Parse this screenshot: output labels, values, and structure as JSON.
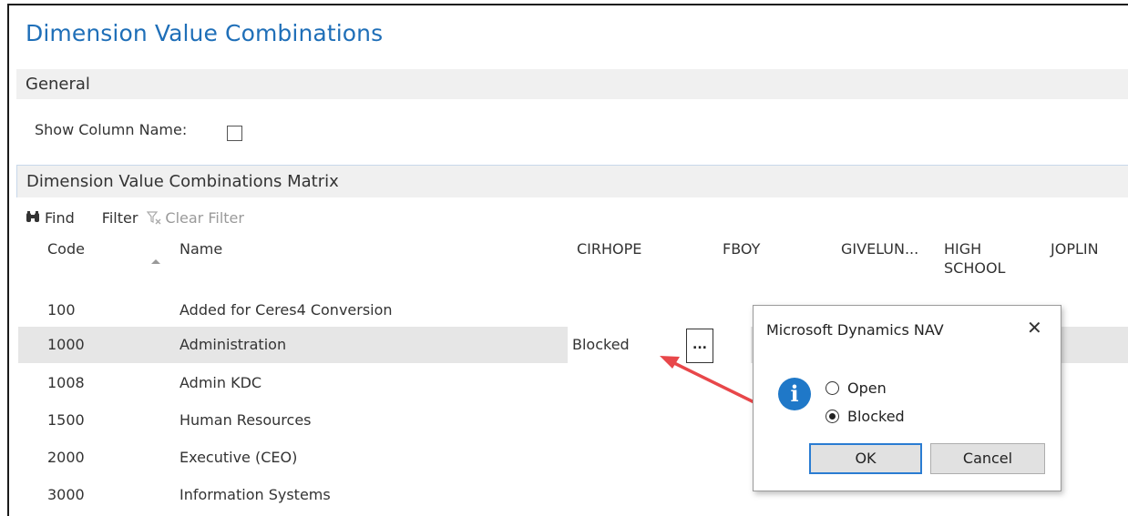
{
  "page": {
    "title": "Dimension Value Combinations"
  },
  "general": {
    "section_label": "General",
    "show_column_name_label": "Show Column Name:",
    "show_column_name_checked": false
  },
  "matrix": {
    "section_label": "Dimension Value Combinations Matrix",
    "toolbar": {
      "find": "Find",
      "filter": "Filter",
      "clear_filter": "Clear Filter"
    },
    "columns": [
      "Code",
      "Name",
      "CIRHOPE",
      "FBOY",
      "GIVELUN...",
      "HIGH SCHOOL",
      "JOPLIN"
    ],
    "high_school_line1": "HIGH",
    "high_school_line2": "SCHOOL",
    "rows": [
      {
        "code": "100",
        "name": "Added for Ceres4 Conversion"
      },
      {
        "code": "1000",
        "name": "Administration",
        "cirhope": "Blocked"
      },
      {
        "code": "1008",
        "name": "Admin KDC"
      },
      {
        "code": "1500",
        "name": "Human Resources"
      },
      {
        "code": "2000",
        "name": "Executive (CEO)"
      },
      {
        "code": "3000",
        "name": "Information Systems"
      }
    ],
    "ellipsis_label": "..."
  },
  "dialog": {
    "title": "Microsoft Dynamics NAV",
    "close_glyph": "✕",
    "options": [
      {
        "label": "Open",
        "selected": false
      },
      {
        "label": "Blocked",
        "selected": true
      }
    ],
    "ok_label": "OK",
    "cancel_label": "Cancel",
    "info_glyph": "i"
  },
  "annotation": {
    "arrow_color": "#e8474a"
  }
}
